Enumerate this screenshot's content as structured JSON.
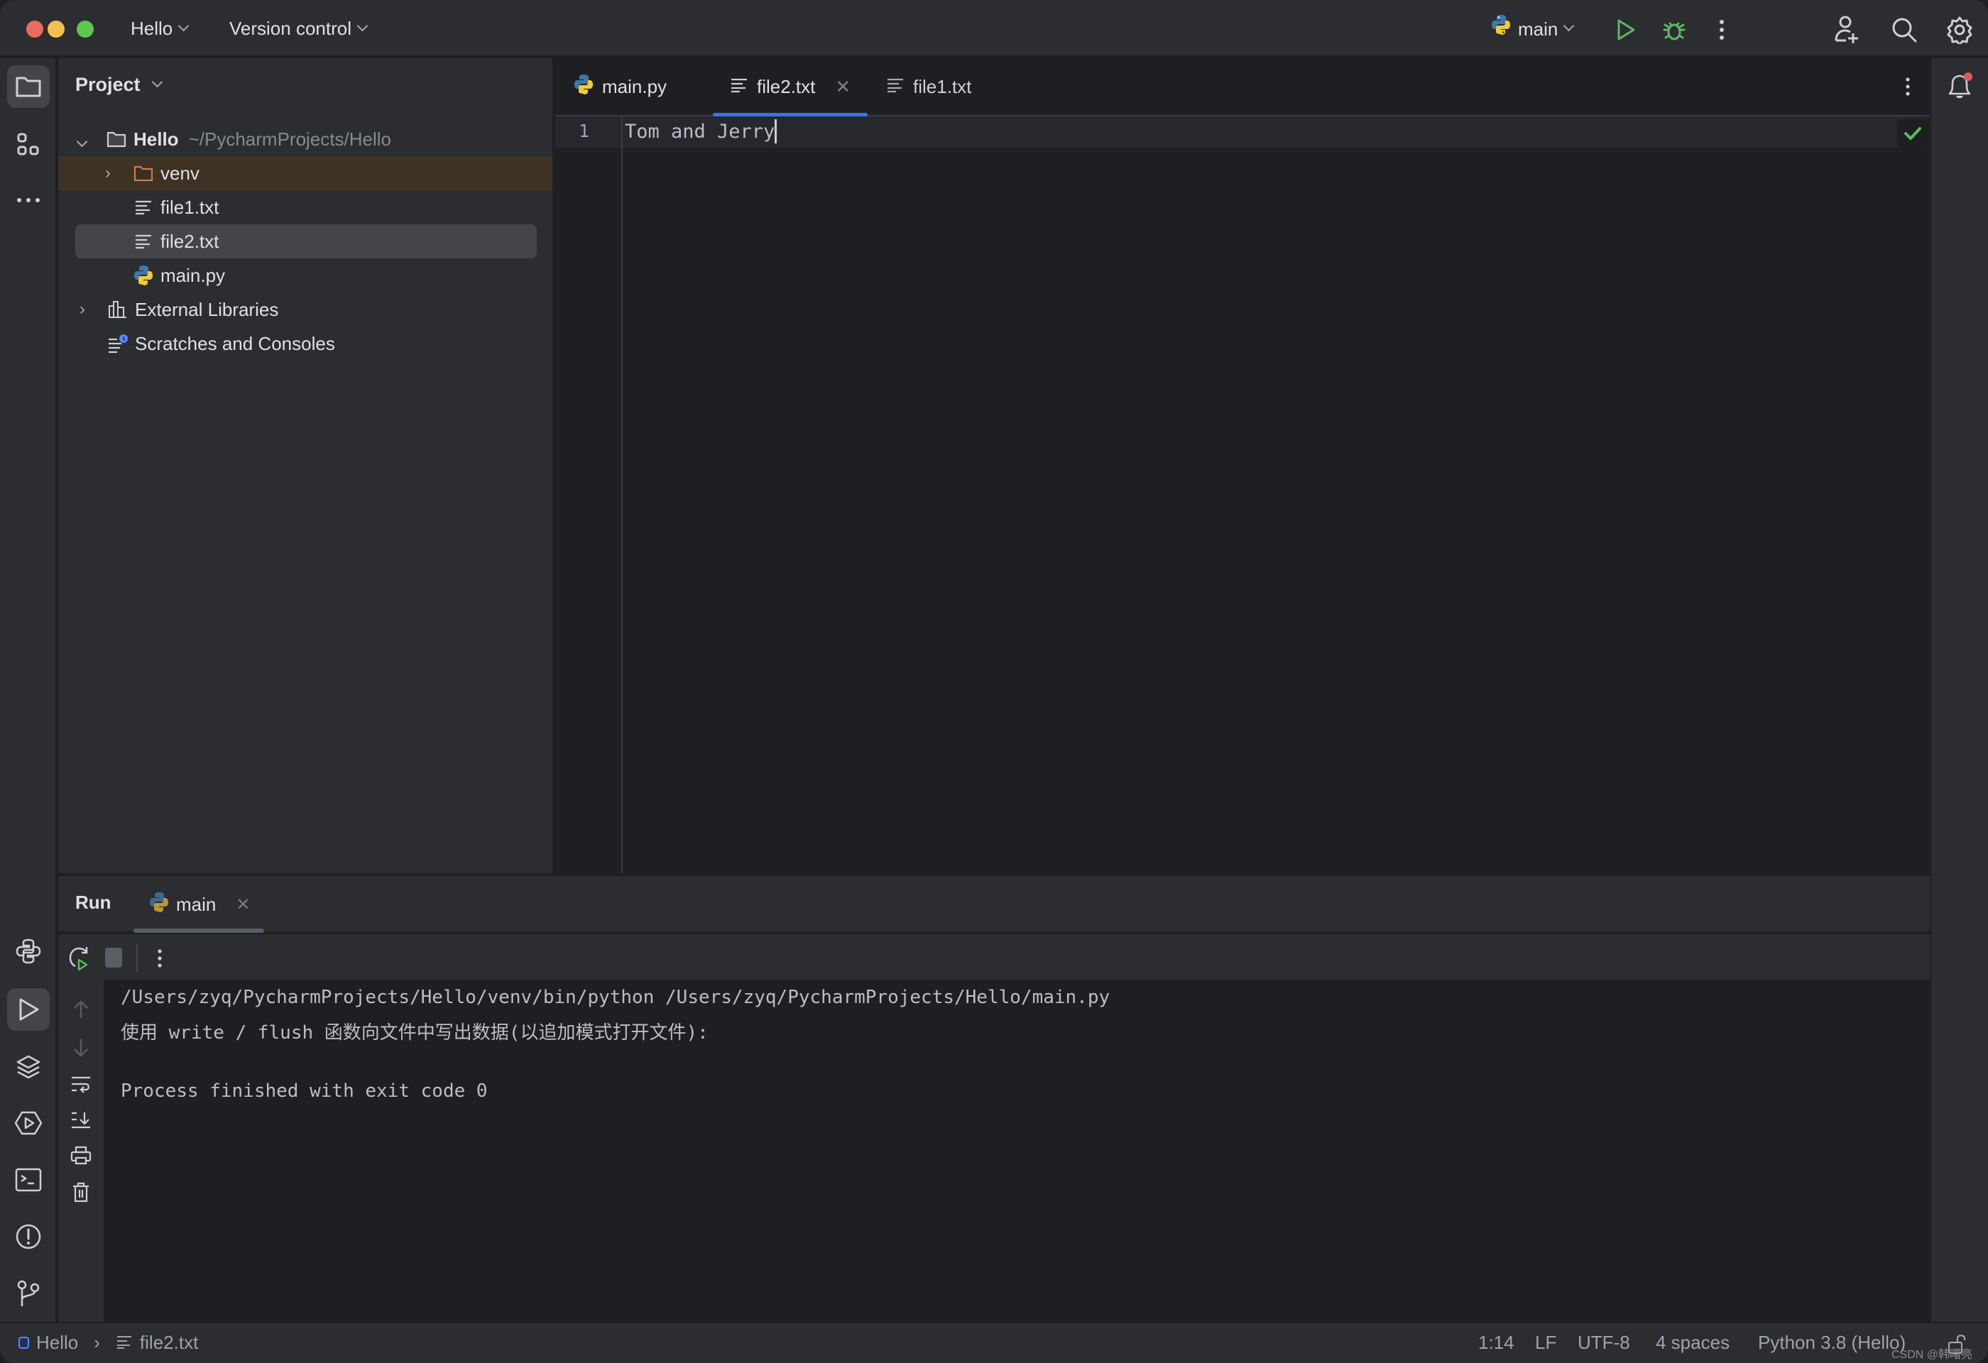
{
  "titlebar": {
    "project_name": "Hello",
    "vcs_label": "Version control",
    "run_config": "main",
    "colors": {
      "close": "#ed6a5e",
      "minimize": "#f5bf4f",
      "maximize": "#61c554",
      "run_green": "#5fb865"
    }
  },
  "left_strip": {
    "top_items": [
      {
        "name": "project-icon",
        "active": true
      },
      {
        "name": "structure-icon",
        "active": false
      },
      {
        "name": "more-icon",
        "active": false
      }
    ],
    "bottom_items": [
      {
        "name": "python-console-icon",
        "active": false
      },
      {
        "name": "run-icon",
        "active": true
      },
      {
        "name": "python-packages-icon",
        "active": false
      },
      {
        "name": "services-icon",
        "active": false
      },
      {
        "name": "terminal-icon",
        "active": false
      },
      {
        "name": "problems-icon",
        "active": false
      },
      {
        "name": "git-icon",
        "active": false
      }
    ]
  },
  "project_panel": {
    "title": "Project",
    "tree": [
      {
        "label": "Hello",
        "hint": "~/PycharmProjects/Hello",
        "type": "root-folder",
        "expanded": true
      },
      {
        "label": "venv",
        "type": "excluded-folder",
        "expanded": false
      },
      {
        "label": "file1.txt",
        "type": "text-file"
      },
      {
        "label": "file2.txt",
        "type": "text-file",
        "selected": true
      },
      {
        "label": "main.py",
        "type": "python-file"
      },
      {
        "label": "External Libraries",
        "type": "libraries",
        "expanded": false
      },
      {
        "label": "Scratches and Consoles",
        "type": "scratches"
      }
    ]
  },
  "editor": {
    "tabs": [
      {
        "label": "main.py",
        "type": "python-file",
        "active": false
      },
      {
        "label": "file2.txt",
        "type": "text-file",
        "active": true,
        "closable": true
      },
      {
        "label": "file1.txt",
        "type": "text-file",
        "active": false
      }
    ],
    "lines": [
      {
        "number": "1",
        "text": "Tom and Jerry"
      }
    ],
    "accent": "#3574f0"
  },
  "run_panel": {
    "title": "Run",
    "tab_label": "main",
    "console_lines": [
      "/Users/zyq/PycharmProjects/Hello/venv/bin/python /Users/zyq/PycharmProjects/Hello/main.py",
      "使用 write / flush 函数向文件中写出数据(以追加模式打开文件):",
      "",
      "Process finished with exit code 0"
    ]
  },
  "status_bar": {
    "breadcrumb_project": "Hello",
    "breadcrumb_file": "file2.txt",
    "position": "1:14",
    "line_separator": "LF",
    "encoding": "UTF-8",
    "indent": "4 spaces",
    "interpreter": "Python 3.8 (Hello)",
    "watermark": "CSDN @韩曙亮"
  }
}
